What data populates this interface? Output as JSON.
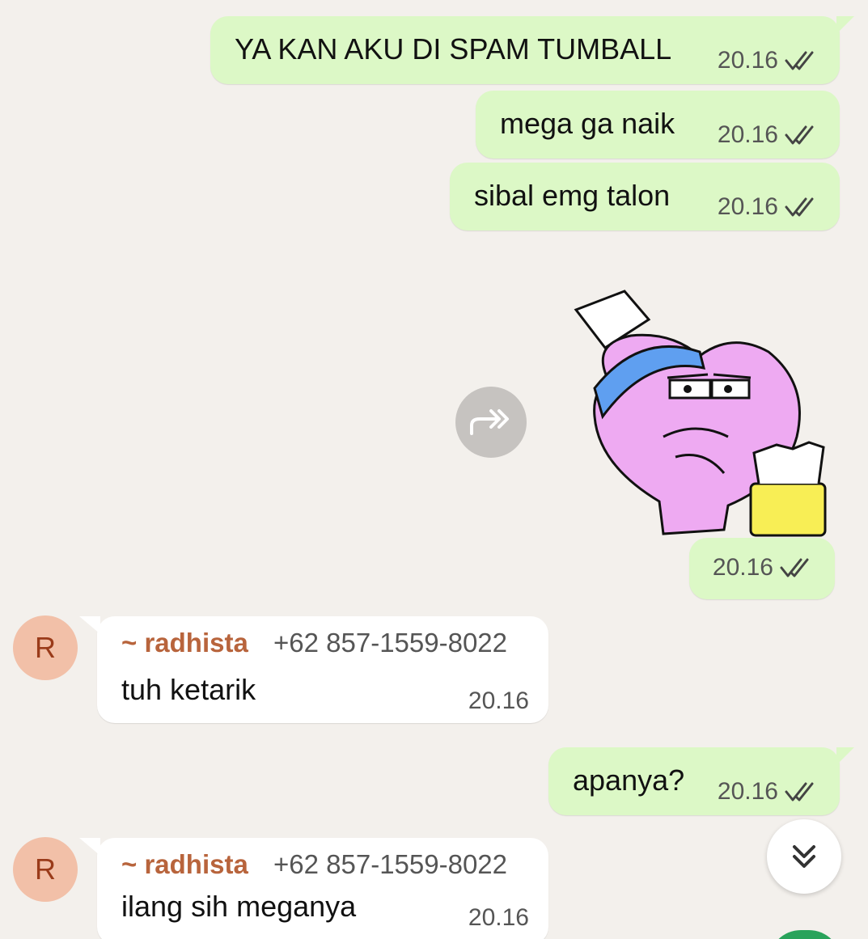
{
  "colors": {
    "background": "#f3f0ec",
    "outgoing_bubble": "#dcf8c6",
    "incoming_bubble": "#ffffff",
    "sender_name": "#b8643c",
    "avatar_bg": "#f2c0a8"
  },
  "messages": {
    "out1": {
      "text": "YA KAN AKU DI SPAM TUMBALL",
      "time": "20.16",
      "status": "read-ticks-icon"
    },
    "out2": {
      "text": "mega ga naik",
      "time": "20.16",
      "status": "read-ticks-icon"
    },
    "out3": {
      "text": "sibal emg talon",
      "time": "20.16",
      "status": "read-ticks-icon"
    },
    "sticker": {
      "time": "20.16",
      "status": "read-ticks-icon"
    },
    "in1": {
      "avatar": "R",
      "sender": "~ radhista",
      "phone": "+62 857-1559-8022",
      "text": "tuh ketarik",
      "time": "20.16"
    },
    "out4": {
      "text": "apanya?",
      "time": "20.16",
      "status": "read-ticks-icon"
    },
    "in2": {
      "avatar": "R",
      "sender": "~ radhista",
      "phone": "+62 857-1559-8022",
      "text": "ilang sih meganya",
      "time": "20.16"
    }
  },
  "controls": {
    "forward_icon": "forward-icon",
    "scroll_icon": "double-chevron-down-icon"
  }
}
